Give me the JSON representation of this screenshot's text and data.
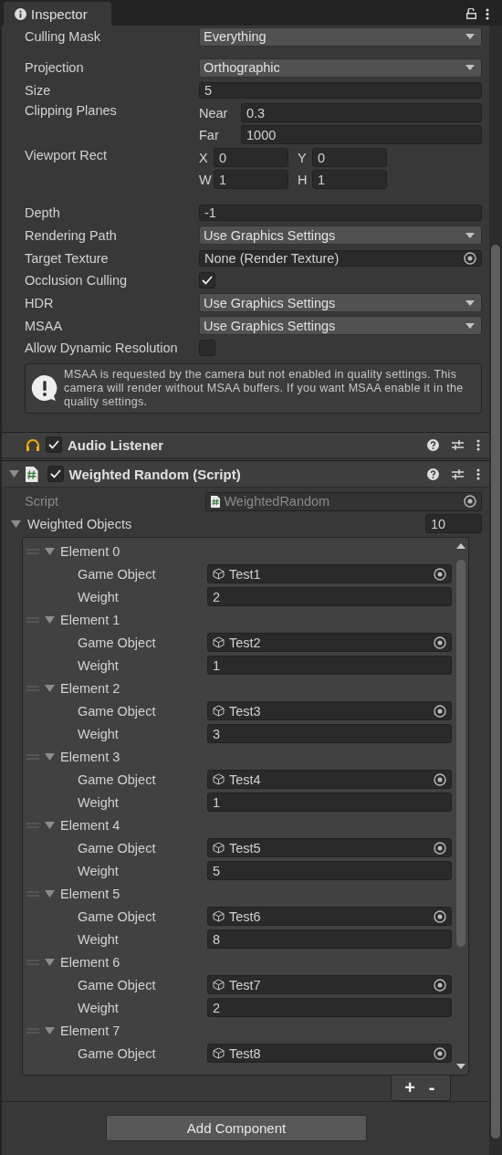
{
  "tab": {
    "title": "Inspector"
  },
  "camera_properties": [
    {
      "kind": "dropdown",
      "label": "Culling Mask",
      "value": "Everything"
    },
    {
      "kind": "dropdown",
      "label": "Projection",
      "value": "Orthographic"
    },
    {
      "kind": "field",
      "label": "Size",
      "value": "5"
    },
    {
      "kind": "rows",
      "label": "Clipping Planes",
      "fields": [
        {
          "label": "Near",
          "value": "0.3"
        },
        {
          "label": "Far",
          "value": "1000"
        }
      ]
    },
    {
      "kind": "grid",
      "label": "Viewport Rect",
      "fields": [
        {
          "label": "X",
          "value": "0"
        },
        {
          "label": "Y",
          "value": "0"
        },
        {
          "label": "W",
          "value": "1"
        },
        {
          "label": "H",
          "value": "1"
        }
      ]
    },
    {
      "kind": "field",
      "label": "Depth",
      "value": "-1"
    },
    {
      "kind": "dropdown",
      "label": "Rendering Path",
      "value": "Use Graphics Settings"
    },
    {
      "kind": "object",
      "label": "Target Texture",
      "value": "None (Render Texture)"
    },
    {
      "kind": "checkbox",
      "label": "Occlusion Culling",
      "checked": true
    },
    {
      "kind": "dropdown",
      "label": "HDR",
      "value": "Use Graphics Settings"
    },
    {
      "kind": "dropdown",
      "label": "MSAA",
      "value": "Use Graphics Settings"
    },
    {
      "kind": "checkbox",
      "label": "Allow Dynamic Resolution",
      "checked": false
    }
  ],
  "help_box": {
    "text": "MSAA is requested by the camera but not enabled in quality settings. This camera will render without MSAA buffers. If you want MSAA enable it in the quality settings."
  },
  "components": [
    {
      "kind": "audio",
      "title": "Audio Listener",
      "enabled": true
    },
    {
      "kind": "script",
      "title": "Weighted Random (Script)",
      "enabled": true
    }
  ],
  "script_field": {
    "label": "Script",
    "value": "WeightedRandom",
    "disabled": true
  },
  "list": {
    "label": "Weighted Objects",
    "count": "10",
    "expanded": true,
    "elements": [
      {
        "label": "Element 0",
        "expanded": true,
        "fields": [
          {
            "kind": "object",
            "label": "Game Object",
            "value": "Test1"
          },
          {
            "kind": "field",
            "label": "Weight",
            "value": "2"
          }
        ]
      },
      {
        "label": "Element 1",
        "expanded": true,
        "fields": [
          {
            "kind": "object",
            "label": "Game Object",
            "value": "Test2"
          },
          {
            "kind": "field",
            "label": "Weight",
            "value": "1"
          }
        ]
      },
      {
        "label": "Element 2",
        "expanded": true,
        "fields": [
          {
            "kind": "object",
            "label": "Game Object",
            "value": "Test3"
          },
          {
            "kind": "field",
            "label": "Weight",
            "value": "3"
          }
        ]
      },
      {
        "label": "Element 3",
        "expanded": true,
        "fields": [
          {
            "kind": "object",
            "label": "Game Object",
            "value": "Test4"
          },
          {
            "kind": "field",
            "label": "Weight",
            "value": "1"
          }
        ]
      },
      {
        "label": "Element 4",
        "expanded": true,
        "fields": [
          {
            "kind": "object",
            "label": "Game Object",
            "value": "Test5"
          },
          {
            "kind": "field",
            "label": "Weight",
            "value": "5"
          }
        ]
      },
      {
        "label": "Element 5",
        "expanded": true,
        "fields": [
          {
            "kind": "object",
            "label": "Game Object",
            "value": "Test6"
          },
          {
            "kind": "field",
            "label": "Weight",
            "value": "8"
          }
        ]
      },
      {
        "label": "Element 6",
        "expanded": true,
        "fields": [
          {
            "kind": "object",
            "label": "Game Object",
            "value": "Test7"
          },
          {
            "kind": "field",
            "label": "Weight",
            "value": "2"
          }
        ]
      },
      {
        "label": "Element 7",
        "expanded": true,
        "fields": [
          {
            "kind": "object",
            "label": "Game Object",
            "value": "Test8"
          }
        ]
      }
    ],
    "buttons": [
      "+",
      "-"
    ]
  },
  "add_component": "Add Component"
}
